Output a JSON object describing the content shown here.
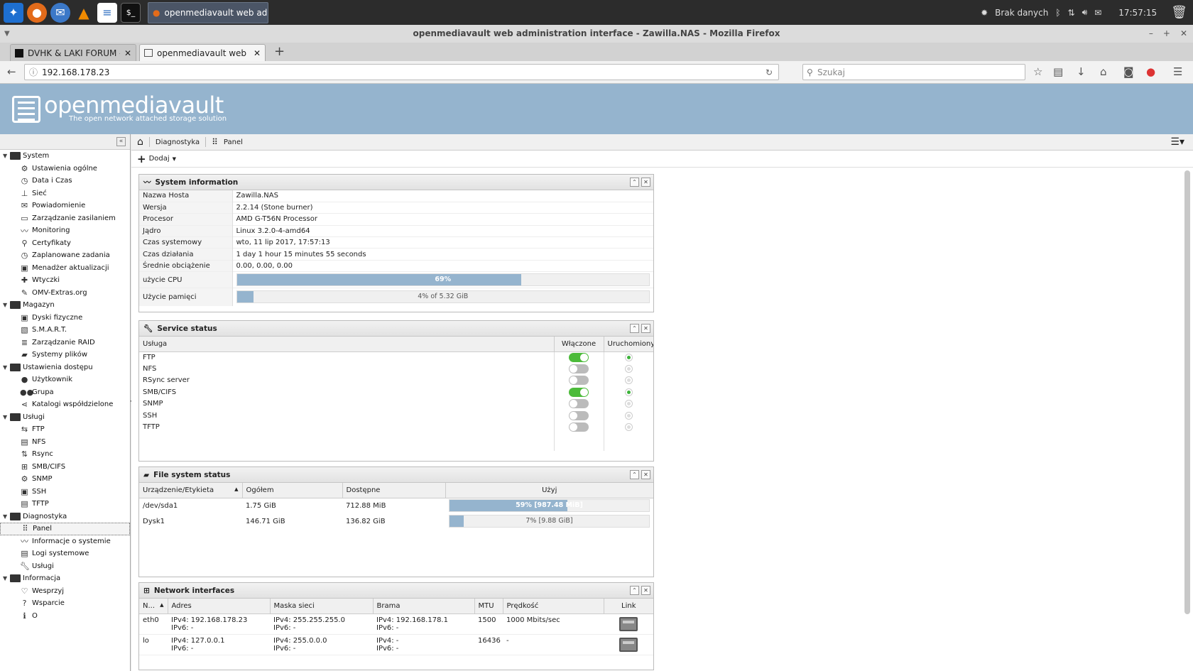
{
  "taskbar": {
    "task_label": "openmediavault web admini...",
    "network_status": "Brak danych",
    "clock": "17:57:15"
  },
  "window": {
    "title": "openmediavault web administration interface - Zawilla.NAS - Mozilla Firefox"
  },
  "tabs": [
    {
      "label": "DVHK & LAKI FORUM - Serv"
    },
    {
      "label": "openmediavault web admin"
    }
  ],
  "navbar": {
    "url": "192.168.178.23",
    "search_placeholder": "Szukaj"
  },
  "header": {
    "brand": "openmediavault",
    "tagline": "The open network attached storage solution"
  },
  "sidebar": {
    "groups": [
      {
        "label": "System",
        "items": [
          "Ustawienia ogólne",
          "Data i Czas",
          "Sieć",
          "Powiadomienie",
          "Zarządzanie zasilaniem",
          "Monitoring",
          "Certyfikaty",
          "Zaplanowane zadania",
          "Menadżer aktualizacji",
          "Wtyczki",
          "OMV-Extras.org"
        ]
      },
      {
        "label": "Magazyn",
        "items": [
          "Dyski fizyczne",
          "S.M.A.R.T.",
          "Zarządzanie RAID",
          "Systemy plików"
        ]
      },
      {
        "label": "Ustawienia dostępu",
        "items": [
          "Użytkownik",
          "Grupa",
          "Katalogi współdzielone"
        ]
      },
      {
        "label": "Usługi",
        "items": [
          "FTP",
          "NFS",
          "Rsync",
          "SMB/CIFS",
          "SNMP",
          "SSH",
          "TFTP"
        ]
      },
      {
        "label": "Diagnostyka",
        "items": [
          "Panel",
          "Informacje o systemie",
          "Logi systemowe",
          "Usługi"
        ]
      },
      {
        "label": "Informacja",
        "items": [
          "Wesprzyj",
          "Wsparcie",
          "O"
        ]
      }
    ]
  },
  "breadcrumb": {
    "item1": "Diagnostyka",
    "item2": "Panel"
  },
  "toolbar": {
    "add_label": "Dodaj"
  },
  "sysinfo": {
    "title": "System information",
    "rows": [
      {
        "k": "Nazwa Hosta",
        "v": "Zawilla.NAS"
      },
      {
        "k": "Wersja",
        "v": "2.2.14 (Stone burner)"
      },
      {
        "k": "Procesor",
        "v": "AMD G-T56N Processor"
      },
      {
        "k": "Jądro",
        "v": "Linux 3.2.0-4-amd64"
      },
      {
        "k": "Czas systemowy",
        "v": "wto, 11 lip 2017, 17:57:13"
      },
      {
        "k": "Czas działania",
        "v": "1 day 1 hour 15 minutes 55 seconds"
      },
      {
        "k": "Średnie obciążenie",
        "v": "0.00, 0.00, 0.00"
      }
    ],
    "cpu_label": "użycie CPU",
    "cpu_text": "69%",
    "cpu_fraction": 0.69,
    "mem_label": "Użycie pamięci",
    "mem_text": "4% of 5.32 GiB",
    "mem_fraction": 0.04
  },
  "service": {
    "title": "Service status",
    "cols": [
      "Usługa",
      "Włączone",
      "Uruchomiony"
    ],
    "rows": [
      {
        "name": "FTP",
        "enabled": true,
        "running": true
      },
      {
        "name": "NFS",
        "enabled": false,
        "running": false
      },
      {
        "name": "RSync server",
        "enabled": false,
        "running": false
      },
      {
        "name": "SMB/CIFS",
        "enabled": true,
        "running": true
      },
      {
        "name": "SNMP",
        "enabled": false,
        "running": false
      },
      {
        "name": "SSH",
        "enabled": false,
        "running": false
      },
      {
        "name": "TFTP",
        "enabled": false,
        "running": false
      }
    ]
  },
  "fs": {
    "title": "File system status",
    "cols": [
      "Urządzenie/Etykieta",
      "Ogółem",
      "Dostępne",
      "Użyj"
    ],
    "rows": [
      {
        "dev": "/dev/sda1",
        "total": "1.75 GiB",
        "avail": "712.88 MiB",
        "used_text": "59% [987.48 MiB]",
        "used": 0.59
      },
      {
        "dev": "Dysk1",
        "total": "146.71 GiB",
        "avail": "136.82 GiB",
        "used_text": "7% [9.88 GiB]",
        "used": 0.07
      }
    ]
  },
  "net": {
    "title": "Network interfaces",
    "cols": [
      "N...",
      "Adres",
      "Maska sieci",
      "Brama",
      "MTU",
      "Prędkość",
      "Link"
    ],
    "rows": [
      {
        "n": "eth0",
        "a1": "IPv4: 192.168.178.23",
        "a2": "IPv6: -",
        "m1": "IPv4: 255.255.255.0",
        "m2": "IPv6: -",
        "b1": "IPv4: 192.168.178.1",
        "b2": "IPv6: -",
        "mtu": "1500",
        "speed": "1000 Mbits/sec"
      },
      {
        "n": "lo",
        "a1": "IPv4: 127.0.0.1",
        "a2": "IPv6: -",
        "m1": "IPv4: 255.0.0.0",
        "m2": "IPv6: -",
        "b1": "IPv4: -",
        "b2": "IPv6: -",
        "mtu": "16436",
        "speed": "-"
      }
    ]
  }
}
